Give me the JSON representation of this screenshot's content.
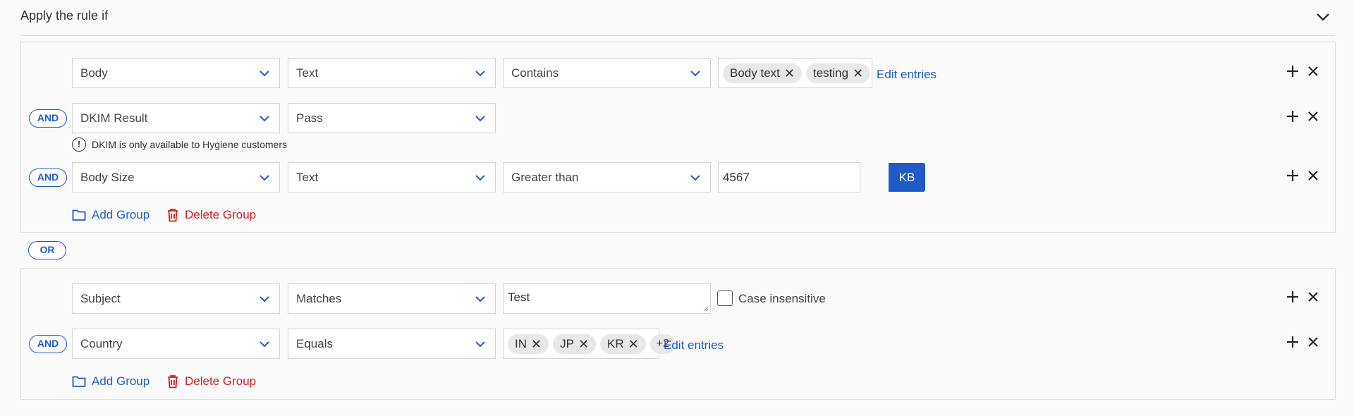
{
  "header": {
    "title": "Apply the rule if"
  },
  "groups": [
    {
      "rows": [
        {
          "field": "Body",
          "type": "Text",
          "operator": "Contains",
          "tags": [
            "Body text",
            "testing"
          ],
          "edit_label": "Edit entries"
        },
        {
          "connector": "AND",
          "field": "DKIM Result",
          "value": "Pass",
          "note": "DKIM is only available to Hygiene customers"
        },
        {
          "connector": "AND",
          "field": "Body Size",
          "type": "Text",
          "operator": "Greater than",
          "value": "4567",
          "unit": "KB"
        }
      ],
      "add_group": "Add Group",
      "delete_group": "Delete Group"
    },
    {
      "rows": [
        {
          "field": "Subject",
          "operator": "Matches",
          "value": "Test",
          "checkbox_label": "Case insensitive",
          "checked": false
        },
        {
          "connector": "AND",
          "field": "Country",
          "operator": "Equals",
          "tags": [
            "IN",
            "JP",
            "KR"
          ],
          "more": "+2",
          "edit_label": "Edit entries"
        }
      ],
      "add_group": "Add Group",
      "delete_group": "Delete Group"
    }
  ],
  "between_groups": "OR",
  "colors": {
    "accent": "#1e5bc6",
    "danger": "#cc1f1f"
  }
}
